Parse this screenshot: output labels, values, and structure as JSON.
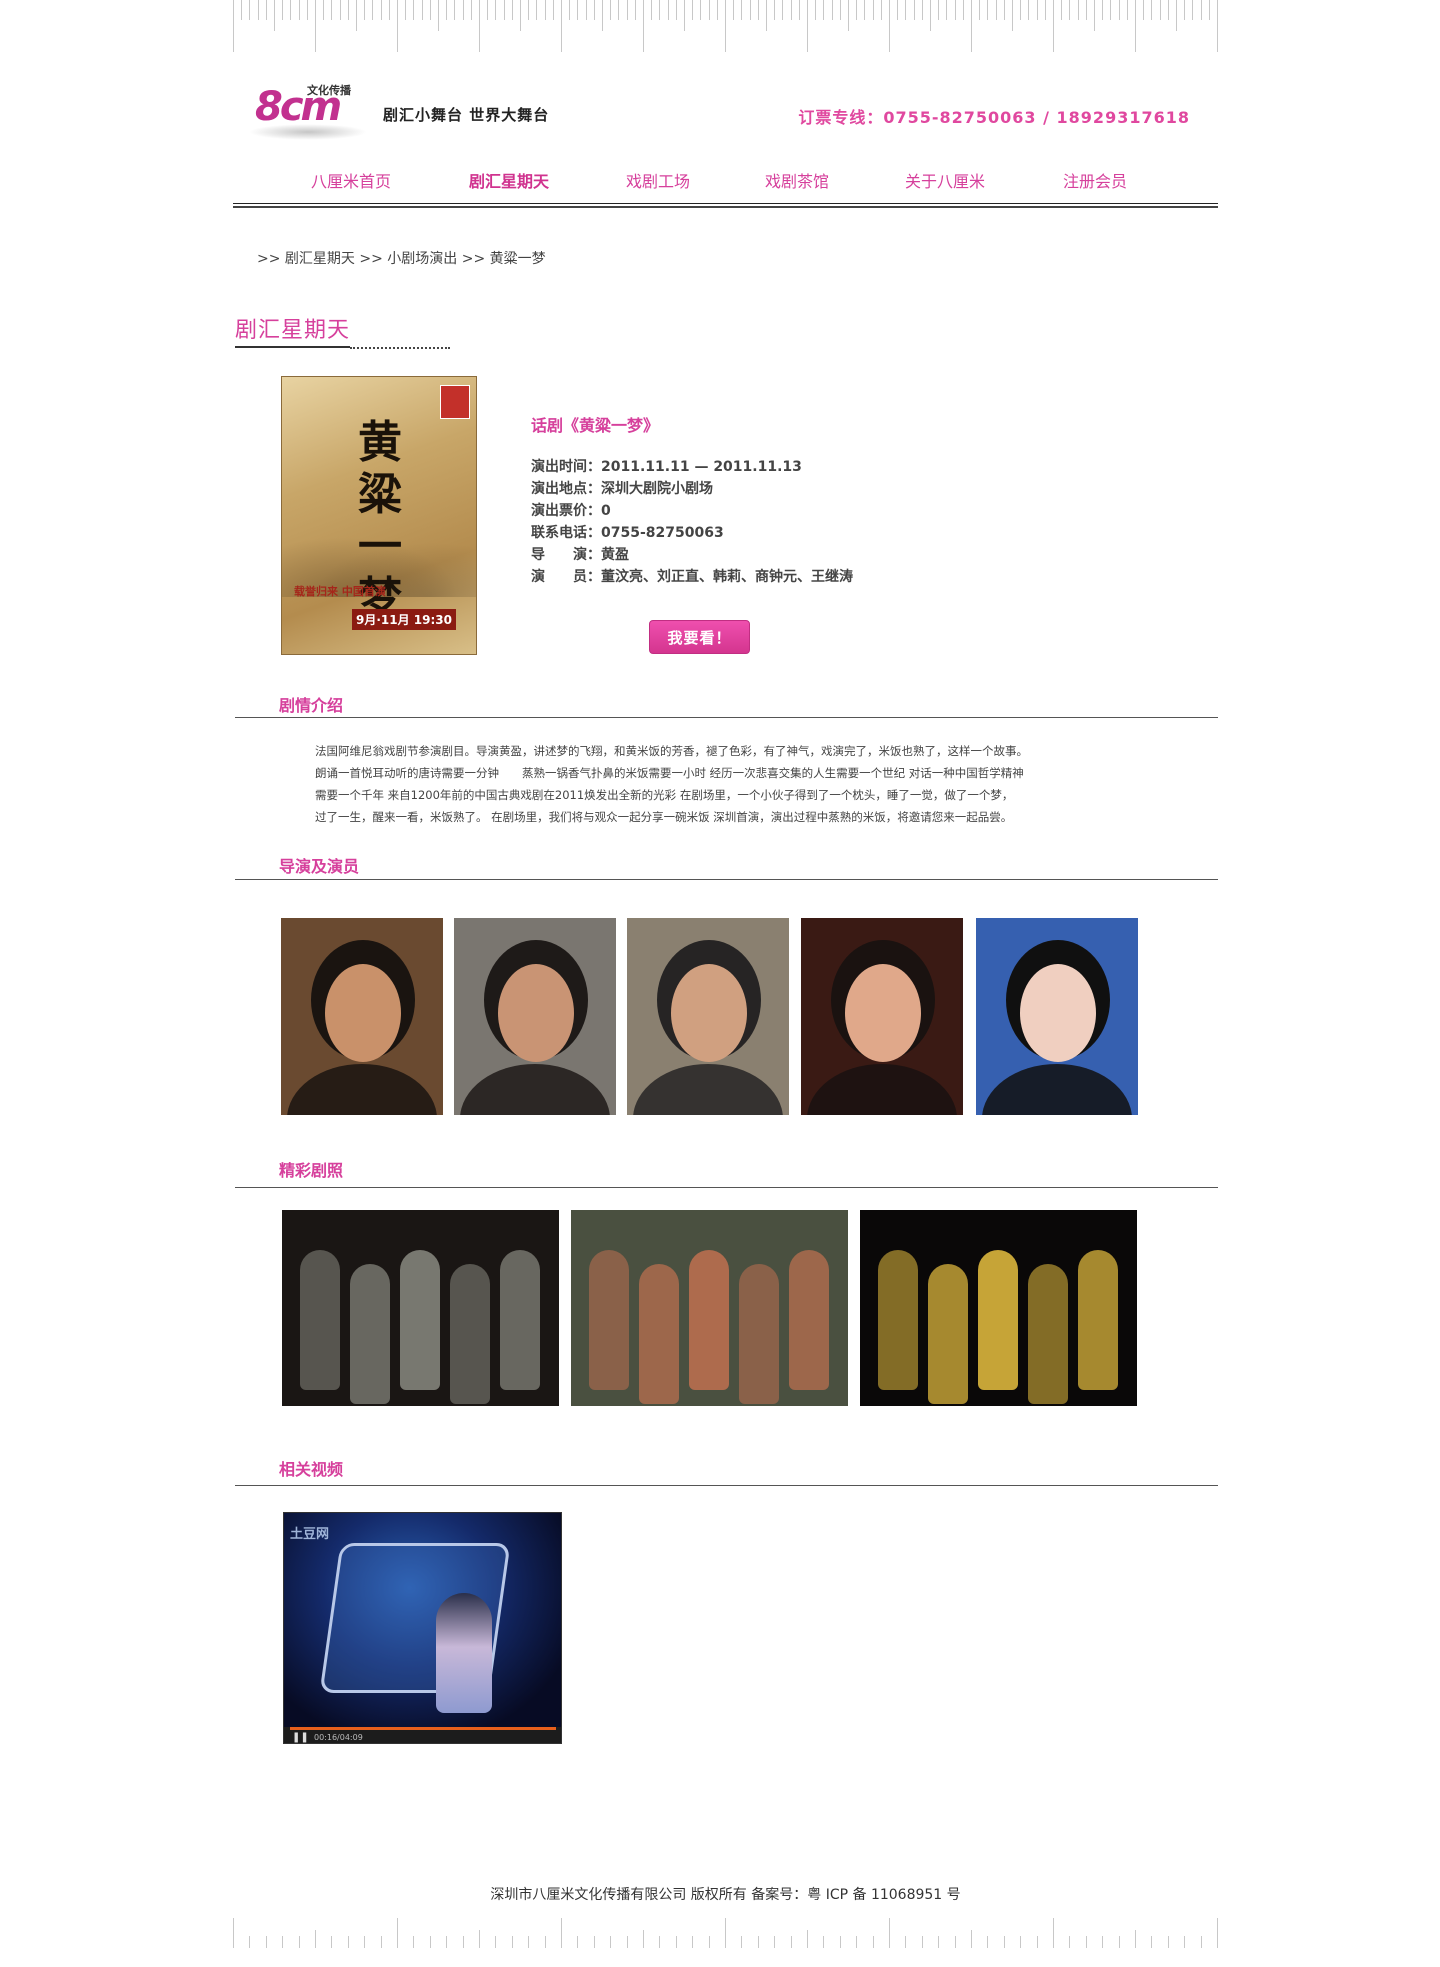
{
  "header": {
    "logo_text": "8cm",
    "logo_subtitle": "文化传播",
    "slogan": "剧汇小舞台  世界大舞台",
    "hotline": "订票专线：0755-82750063 / 18929317618"
  },
  "nav": {
    "items": [
      {
        "label": "八厘米首页"
      },
      {
        "label": "剧汇星期天",
        "active": true
      },
      {
        "label": "戏剧工场"
      },
      {
        "label": "戏剧茶馆"
      },
      {
        "label": "关于八厘米"
      },
      {
        "label": "注册会员"
      }
    ]
  },
  "breadcrumb": {
    "sep": ">>",
    "items": [
      "剧汇星期天",
      "小剧场演出",
      "黄粱一梦"
    ]
  },
  "section_title": "剧汇星期天",
  "poster": {
    "title": "黄粱一梦",
    "band": "载誉归来  中国首演",
    "date": "9月·11月 19:30"
  },
  "show": {
    "title": "话剧《黄粱一梦》",
    "rows": [
      "演出时间：2011.11.11 — 2011.11.13",
      "演出地点：深圳大剧院小剧场",
      "演出票价：0",
      "联系电话：0755-82750063",
      "导　　演：黄盈",
      "演　　员：董汶亮、刘正直、韩莉、商钟元、王继涛"
    ],
    "button": "我要看！"
  },
  "synopsis": {
    "title": "剧情介绍",
    "lines": [
      "法国阿维尼翁戏剧节参演剧目。导演黄盈，讲述梦的飞翔，和黄米饭的芳香，褪了色彩，有了神气，戏演完了，米饭也熟了，这样一个故事。",
      "朗诵一首悦耳动听的唐诗需要一分钟　　蒸熟一锅香气扑鼻的米饭需要一小时  经历一次悲喜交集的人生需要一个世纪  对话一种中国哲学精神",
      "需要一个千年  来自1200年前的中国古典戏剧在2011焕发出全新的光彩  在剧场里，一个小伙子得到了一个枕头，睡了一觉，做了一个梦，",
      "过了一生，醒来一看，米饭熟了。  在剧场里，我们将与观众一起分享一碗米饭  深圳首演，演出过程中蒸熟的米饭，将邀请您来一起品尝。"
    ]
  },
  "cast": {
    "title": "导演及演员",
    "photos": [
      {
        "bg": "#6a4a30",
        "face": "#c9916a",
        "hair": "#1a1410"
      },
      {
        "bg": "#7a7670",
        "face": "#c99474",
        "hair": "#1e1a18"
      },
      {
        "bg": "#8a8070",
        "face": "#d0a080",
        "hair": "#262424"
      },
      {
        "bg": "#3a1a14",
        "face": "#e0a88a",
        "hair": "#1a1210"
      },
      {
        "bg": "#3660b0",
        "face": "#f0cfc0",
        "hair": "#101010"
      }
    ]
  },
  "stills": {
    "title": "精彩剧照",
    "photos": [
      {
        "bg": "#1a1614",
        "accent": "#8a8a80"
      },
      {
        "bg": "#4a5040",
        "accent": "#c07050"
      },
      {
        "bg": "#0a0808",
        "accent": "#e8c040"
      }
    ]
  },
  "video": {
    "title": "相关视频",
    "watermark": "土豆网",
    "time": "00:16/04:09"
  },
  "footer": {
    "text": "深圳市八厘米文化传播有限公司 版权所有    备案号：粤 ICP 备 11068951 号"
  },
  "colors": {
    "brand_pink": "#d6409c",
    "text": "#444444"
  }
}
